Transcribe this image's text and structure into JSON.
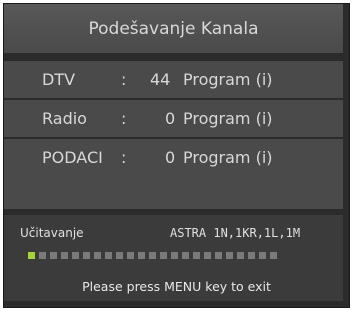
{
  "menu": {
    "title": "Podešavanje Kanala"
  },
  "rows": [
    {
      "label": "DTV",
      "colon": ":",
      "value": "44",
      "unit": "Program (i)"
    },
    {
      "label": "Radio",
      "colon": ":",
      "value": "0",
      "unit": "Program (i)"
    },
    {
      "label": "PODACI",
      "colon": ":",
      "value": "0",
      "unit": "Program (i)"
    }
  ],
  "status": {
    "label": "Učitavanje",
    "satellite": "ASTRA 1N,1KR,1L,1M"
  },
  "progress": {
    "filled_segments": 1,
    "total_segments": 23,
    "fill_color": "#a6d23a",
    "empty_color": "#7a7a7a"
  },
  "footer": {
    "exit_message": "Please press MENU key to exit"
  }
}
